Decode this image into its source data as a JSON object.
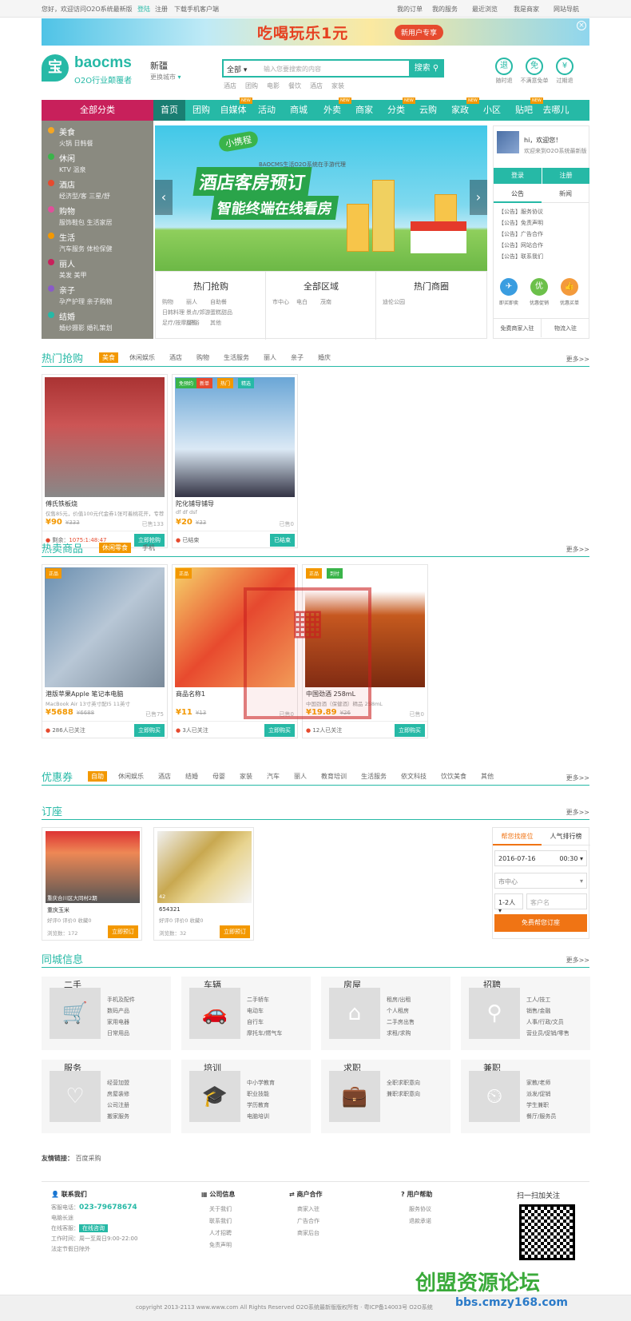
{
  "topbar": {
    "welcome": "您好，欢迎访问O2O系统最新版",
    "login": "登陆",
    "register": "注册",
    "mobile": "下载手机客户端",
    "my_orders": "我的订单",
    "my_services": "我的服务",
    "recent": "最近浏览",
    "i_am_merchant": "我是商家",
    "site_nav": "网站导航"
  },
  "banner": {
    "title": "吃喝玩乐1元",
    "tag": "新用户专享",
    "close": "×"
  },
  "logo": {
    "mark": "宝",
    "name": "baocms",
    "slogan": "O2O行业颠覆者"
  },
  "city": {
    "name": "新疆",
    "switch": "更换城市"
  },
  "search": {
    "scope": "全部",
    "placeholder": "输入您要搜索的内容",
    "button": "搜索",
    "hot": [
      "酒店",
      "团购",
      "电影",
      "餐饮",
      "酒店",
      "家装"
    ]
  },
  "quick": [
    {
      "icon": "退",
      "label": "随时退",
      "color": "#26b9a6"
    },
    {
      "icon": "免",
      "label": "不满意免单",
      "color": "#26b9a6"
    },
    {
      "icon": "¥",
      "label": "过期退",
      "color": "#26b9a6"
    }
  ],
  "nav": {
    "all": "全部分类",
    "items": [
      "首页",
      "团购",
      "自媒体",
      "活动",
      "商城",
      "外卖",
      "商家",
      "分类",
      "云购",
      "家政",
      "小区",
      "贴吧",
      "去哪儿"
    ],
    "new_label": "NEW"
  },
  "categories": [
    {
      "t": "美食",
      "s": "火锅  日韩餐"
    },
    {
      "t": "休闲",
      "s": "KTV  温泉"
    },
    {
      "t": "酒店",
      "s": "经济型/客  三星/舒"
    },
    {
      "t": "购物",
      "s": "服饰鞋包  生活家居"
    },
    {
      "t": "生活",
      "s": "汽车服务  体检保健"
    },
    {
      "t": "丽人",
      "s": "美发  美甲"
    },
    {
      "t": "亲子",
      "s": "孕产护理  亲子购物"
    },
    {
      "t": "结婚",
      "s": "婚纱摄影  婚礼策划"
    }
  ],
  "slider": {
    "tag": "小携程",
    "line1": "酒店客房预订",
    "line2": "智能终端在线看房",
    "caption": "BAOCMS生活O2O系统在手游代理",
    "prev": "‹",
    "next": "›"
  },
  "hotpanel": [
    {
      "h": "热门抢购",
      "links": [
        "购物",
        "丽人",
        "自助餐",
        "日韩料理",
        "景点/郊游",
        "蛋糕甜品",
        "足疗/按摩/洗浴",
        "摄影",
        "其他"
      ]
    },
    {
      "h": "全部区域",
      "links": [
        "市中心",
        "电白",
        "茂南"
      ]
    },
    {
      "h": "热门商圈",
      "links": [
        "迪伦公园"
      ]
    }
  ],
  "user": {
    "hi": "hi，欢迎您！",
    "welcome": "欢迎来到O2O系统最新版",
    "login": "登录",
    "register": "注册",
    "tab1": "公告",
    "tab2": "新闻",
    "ann": [
      "【公告】服务协议",
      "【公告】免责声明",
      "【公告】广告合作",
      "【公告】网站合作",
      "【公告】联系我们"
    ],
    "circles": [
      {
        "i": "✈",
        "l": "即买即卖",
        "c": "#3a9de0"
      },
      {
        "i": "优",
        "l": "优惠促销",
        "c": "#6cc04a"
      },
      {
        "i": "👍",
        "l": "优惠买单",
        "c": "#f39a3c"
      }
    ],
    "b1": "免费商家入驻",
    "b2": "物流入驻"
  },
  "hotbuy": {
    "title": "热门抢购",
    "tabs": [
      "美食",
      "休闲娱乐",
      "酒店",
      "购物",
      "生活服务",
      "丽人",
      "亲子",
      "婚庆"
    ],
    "more": "更多>>",
    "items": [
      {
        "name": "傅氏铁板烧",
        "desc": "仅售85元，价值100元代金券1张可着桃花开，专荐",
        "price": "¥90",
        "old": "¥333",
        "sold": "已售133",
        "loc": "剩余：",
        "time": "1075:1:48:47",
        "btn": "立即抢购",
        "badges": []
      },
      {
        "name": "陀化铺导铺导",
        "desc": "df df dsf",
        "price": "¥20",
        "old": "¥33",
        "sold": "已售0",
        "loc": "已结束",
        "time": "",
        "btn": "已结束",
        "badges": [
          {
            "t": "免预约",
            "c": "#3ab44a"
          },
          {
            "t": "新单",
            "c": "#e64a2e"
          },
          {
            "t": "热门",
            "c": "#f39800"
          },
          {
            "t": "精选",
            "c": "#26b9a6"
          }
        ]
      }
    ]
  },
  "hotsale": {
    "title": "热卖商品",
    "tabs": [
      "休闲零食",
      "手机"
    ],
    "more": "更多>>",
    "items": [
      {
        "name": "港版苹果Apple 笔记本电脑",
        "desc": "MacBook Air 13寸英寸配I5 11英寸",
        "price": "¥5688",
        "old": "¥6688",
        "sold": "已售75",
        "loc": "286人已关注",
        "btn": "立即购买",
        "badges": [
          {
            "t": "正品",
            "c": "#f39800"
          }
        ]
      },
      {
        "name": "商品名称1",
        "desc": "",
        "price": "¥11",
        "old": "¥13",
        "sold": "已售0",
        "loc": "3人已关注",
        "btn": "立即购买",
        "badges": [
          {
            "t": "正品",
            "c": "#f39800"
          }
        ]
      },
      {
        "name": "中国劲酒 258mL",
        "desc": "中国劲酒（保健酒）精品 258mL",
        "price": "¥19.89",
        "old": "¥26",
        "sold": "已售0",
        "loc": "12人已关注",
        "btn": "立即购买",
        "badges": [
          {
            "t": "正品",
            "c": "#f39800"
          },
          {
            "t": "到付",
            "c": "#3ab44a"
          }
        ]
      }
    ]
  },
  "coupons": {
    "title": "优惠券",
    "tabs": [
      "自助",
      "休闲娱乐",
      "酒店",
      "结婚",
      "母婴",
      "家装",
      "汽车",
      "丽人",
      "教育培训",
      "生活服务",
      "依文科技",
      "饮饮美食",
      "其他"
    ],
    "more": "更多>>"
  },
  "booking": {
    "title": "订座",
    "more": "更多>>",
    "items": [
      {
        "caption": "重庆合川区大同村2期",
        "name": "重庆玉米",
        "stats": "好评0  评价0  收藏0",
        "views": "浏览数：172",
        "btn": "立即预订"
      },
      {
        "caption": "42",
        "name": "654321",
        "stats": "好评0  评价0  收藏0",
        "views": "浏览数：32",
        "btn": "立即预订"
      }
    ],
    "form": {
      "tab1": "帮您找座位",
      "tab2": "人气排行榜",
      "date": "2016-07-16",
      "time": "00:30",
      "area": "市中心",
      "people": "1-2人",
      "name_ph": "客户名",
      "submit": "免费帮您订座"
    }
  },
  "citylife": {
    "title": "同城信息",
    "more": "更多>>",
    "blocks": [
      {
        "h": "二手",
        "icon": "🛒",
        "links": [
          "手机及配件",
          "数码产品",
          "家用电器",
          "日常用品"
        ]
      },
      {
        "h": "车辆",
        "icon": "🚗",
        "links": [
          "二手轿车",
          "电动车",
          "自行车",
          "摩托车/燃气车"
        ]
      },
      {
        "h": "房屋",
        "icon": "⌂",
        "links": [
          "租房/出租",
          "个人租房",
          "二手房出售",
          "求租/求购"
        ]
      },
      {
        "h": "招聘",
        "icon": "⚲",
        "links": [
          "工人/技工",
          "销售/金融",
          "人事/行政/文员",
          "营业员/促销/零售"
        ]
      },
      {
        "h": "服务",
        "icon": "♡",
        "links": [
          "经营加盟",
          "房屋装修",
          "公司注册",
          "搬家服务"
        ]
      },
      {
        "h": "培训",
        "icon": "🎓",
        "links": [
          "中小学教育",
          "职业技能",
          "学历教育",
          "电脑培训"
        ]
      },
      {
        "h": "求职",
        "icon": "💼",
        "links": [
          "全职求职意向",
          "兼职求职意向"
        ]
      },
      {
        "h": "兼职",
        "icon": "⏲",
        "links": [
          "家教/老师",
          "派发/促销",
          "学生兼职",
          "餐厅/服务员"
        ]
      }
    ]
  },
  "friends": {
    "label": "友情链接：",
    "link": "百度采购"
  },
  "footer": {
    "contact": {
      "h": "联系我们",
      "phone_label": "客服电话：",
      "phone": "023-79678674",
      "qq_label": "在线客服：",
      "qq": "在线咨询",
      "hours_label": "工作时间：",
      "hours": "周一至周日9:00-22:00",
      "note": "法定节假日除外",
      "city": "电脑长途"
    },
    "company": {
      "h": "公司信息",
      "links": [
        "关于我们",
        "联系我们",
        "人才招聘",
        "免责声明"
      ]
    },
    "merchant": {
      "h": "商户合作",
      "links": [
        "商家入驻",
        "广告合作",
        "商家后台"
      ]
    },
    "help": {
      "h": "用户帮助",
      "links": [
        "服务协议",
        "退款承诺"
      ]
    },
    "qr": "扫一扫加关注"
  },
  "copyright": "copyright 2013-2113 www.www.com All Rights Reserved O2O系统最新版版权所有 · 粤ICP备14003号 O2O系统",
  "watermark": "bbs.cmzy168.com",
  "watermark_title": "创盟资源论坛"
}
